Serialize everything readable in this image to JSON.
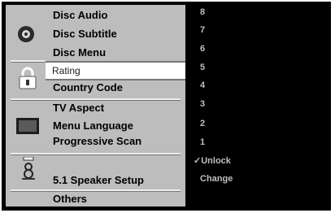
{
  "menu": {
    "disc": {
      "icon": "disc-icon",
      "items": [
        "Disc Audio",
        "Disc Subtitle",
        "Disc Menu"
      ]
    },
    "lock": {
      "icon": "padlock-icon",
      "items": [
        "Rating",
        "Country Code"
      ]
    },
    "display": {
      "icon": "tv-screen-icon",
      "items": [
        "TV Aspect",
        "Menu Language",
        "Progressive Scan"
      ]
    },
    "audio": {
      "icon": "speaker-icon",
      "items": [
        "5.1 Speaker Setup"
      ]
    },
    "others": {
      "items": [
        "Others"
      ]
    }
  },
  "rating_options": {
    "values": [
      "8",
      "7",
      "6",
      "5",
      "4",
      "3",
      "2",
      "1"
    ],
    "unlock_label": "Unlock",
    "unlock_checkmark": "✓",
    "change_label": "Change"
  },
  "colors": {
    "panel": "#bdbdbd",
    "highlight": "#ffffff",
    "options_background": "#000000",
    "options_text": "#bfbfbf"
  }
}
